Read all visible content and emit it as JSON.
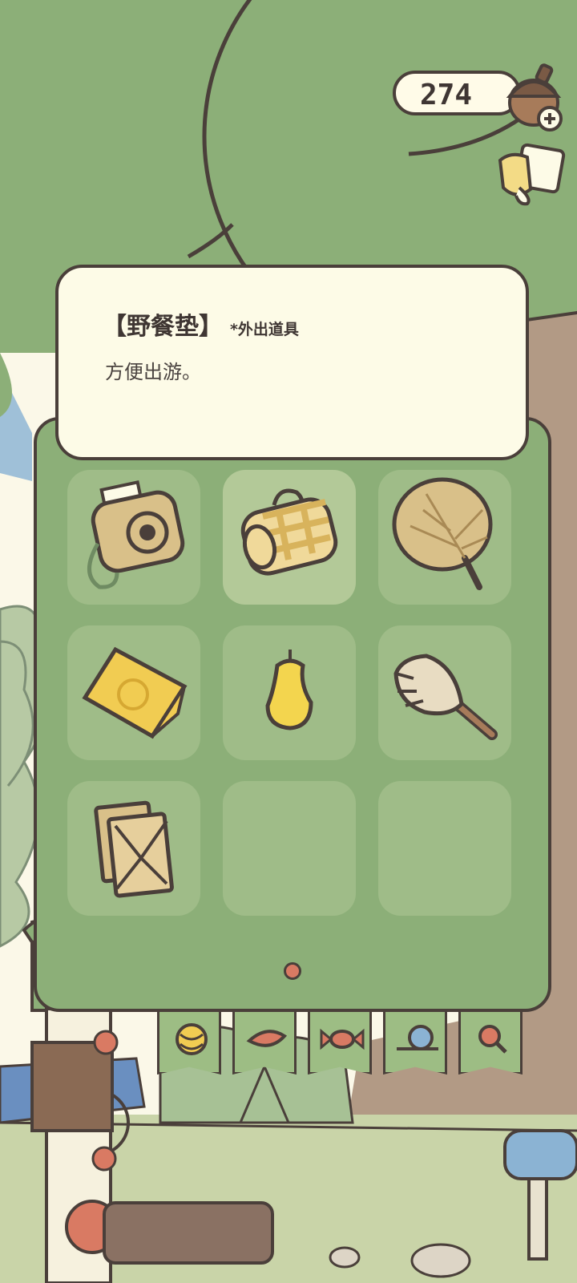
{
  "hud": {
    "acorn_count": "274",
    "acorn_icon": "acorn-plus-icon",
    "shop_icon": "mug-icon"
  },
  "item_info": {
    "name": "【野餐垫】",
    "tag": "*外出道具",
    "description": "方便出游。"
  },
  "inventory": {
    "slots": [
      {
        "icon": "instant-camera-icon",
        "selected": false
      },
      {
        "icon": "picnic-mat-icon",
        "selected": true
      },
      {
        "icon": "palm-fan-icon",
        "selected": false
      },
      {
        "icon": "map-pamphlet-icon",
        "selected": false
      },
      {
        "icon": "candle-icon",
        "selected": false
      },
      {
        "icon": "feather-duster-icon",
        "selected": false
      },
      {
        "icon": "envelope-icon",
        "selected": false
      },
      {
        "icon": "empty",
        "selected": false
      },
      {
        "icon": "empty",
        "selected": false
      }
    ],
    "page": 1
  },
  "category_tabs": [
    {
      "icon": "yarn-ball-icon"
    },
    {
      "icon": "leaf-food-icon"
    },
    {
      "icon": "candy-icon"
    },
    {
      "icon": "snail-icon"
    },
    {
      "icon": "magnifier-icon"
    }
  ],
  "colors": {
    "panel": "#8caf78",
    "card": "#fdfbe7",
    "outline": "#4a3f3a",
    "accent_dot": "#d97a63"
  }
}
